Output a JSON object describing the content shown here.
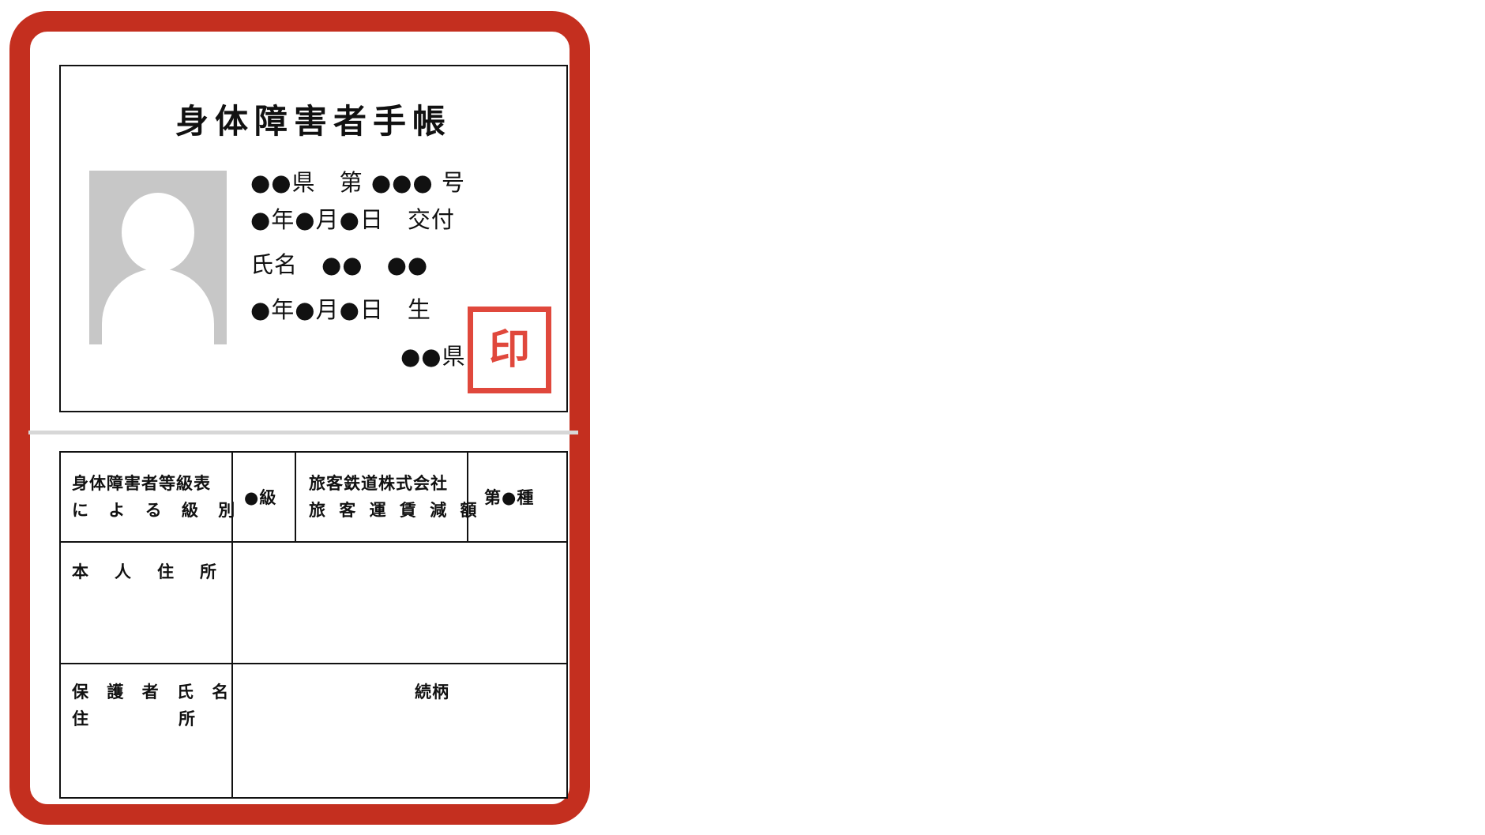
{
  "card": {
    "title": "身体障害者手帳",
    "issuer_number": "●●県　第 ●●● 号",
    "issue_date": "●年●月●日　交付",
    "name": "氏名　●●　●●",
    "birth_date": "●年●月●日　生",
    "prefecture": "●●県",
    "seal": "印"
  },
  "table": {
    "grade_header_line1": "身体障害者等級表",
    "grade_header_line2": "に よ る 級 別",
    "grade_value": "●級",
    "fare_header_line1": "旅客鉄道株式会社",
    "fare_header_line2": "旅 客 運 賃 減 額",
    "fare_value": "第●種",
    "address_label": "本　人　住　所",
    "guardian_label_line1": "保 護 者 氏 名",
    "guardian_label_line2": "住　　　　所",
    "relationship_label": "続柄"
  }
}
